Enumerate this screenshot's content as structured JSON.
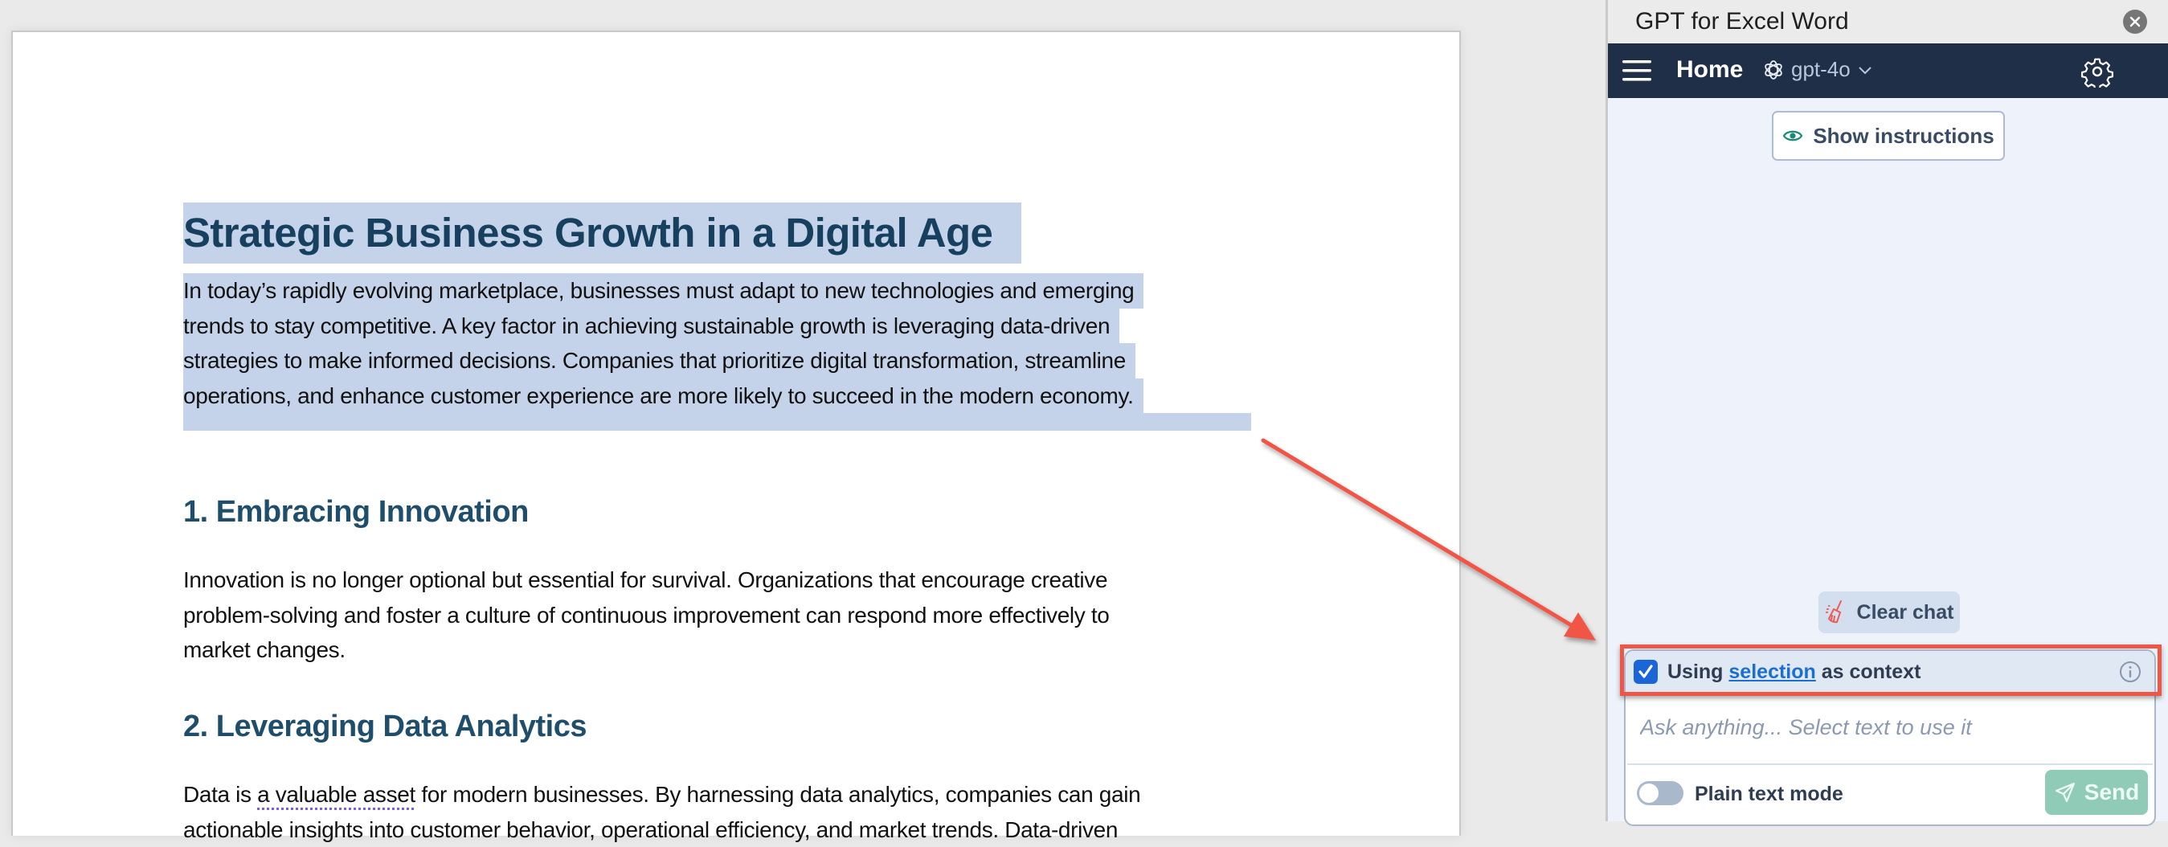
{
  "document": {
    "title": "Strategic Business Growth in a Digital Age",
    "intro_lines": [
      "In today’s rapidly evolving marketplace, businesses must adapt to new technologies and emerging",
      "trends to stay competitive. A key factor in achieving sustainable growth is leveraging data-driven",
      "strategies to make informed decisions. Companies that prioritize digital transformation, streamline",
      "operations, and enhance customer experience are more likely to succeed in the modern economy."
    ],
    "sections": [
      {
        "heading": "1. Embracing Innovation",
        "lines": [
          "Innovation is no longer optional but essential for survival. Organizations that encourage creative",
          "problem-solving and foster a culture of continuous improvement can respond more effectively to",
          "market changes."
        ]
      },
      {
        "heading": "2. Leveraging Data Analytics",
        "line1_before": "Data is ",
        "line1_flagged": "a valuable asset",
        "line1_after": " for modern businesses. By harnessing data analytics, companies can gain",
        "line2": "actionable insights into customer behavior, operational efficiency, and market trends. Data-driven"
      }
    ]
  },
  "pane": {
    "title": "GPT for Excel Word",
    "close_icon": "close-circle-icon",
    "nav": {
      "menu_icon": "hamburger-icon",
      "home_label": "Home",
      "model_icon": "openai-logo-icon",
      "model": "gpt-4o",
      "settings_icon": "gear-icon"
    },
    "show_instructions": "Show instructions",
    "clear_chat": "Clear chat",
    "context": {
      "checked": true,
      "prefix": "Using",
      "link": "selection",
      "suffix": "as context"
    },
    "input_placeholder": "Ask anything... Select text to use it",
    "plain_text_mode": {
      "label": "Plain text mode",
      "on": false
    },
    "send_label": "Send"
  },
  "annotation": {
    "arrow_color": "#f05545",
    "highlight_color": "#f05545"
  },
  "colors": {
    "selection_highlight": "#c5d3ea",
    "navbar": "#1f2f47",
    "heading": "#17405f",
    "send_button": "#90cbb8",
    "link": "#1a6fd1"
  }
}
